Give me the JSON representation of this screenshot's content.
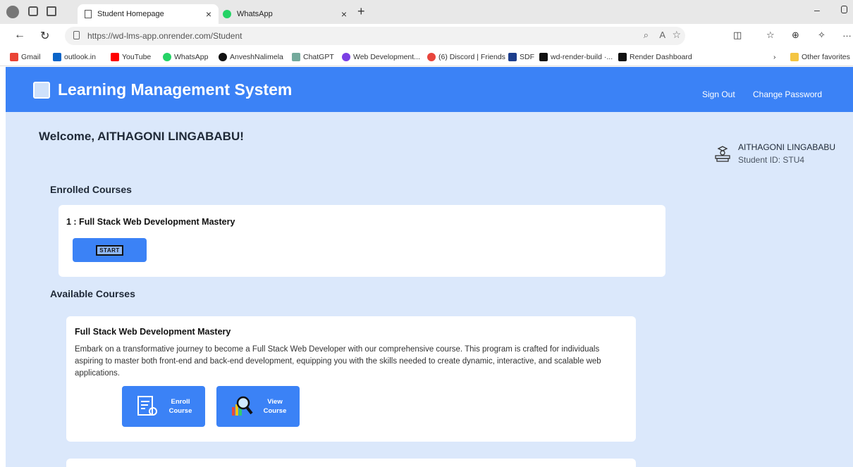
{
  "browser": {
    "tabs": [
      {
        "label": "Student Homepage",
        "active": true
      },
      {
        "label": "WhatsApp",
        "active": false
      }
    ],
    "url": "https://wd-lms-app.onrender.com/Student",
    "bookmarks": [
      "Gmail",
      "outlook.in",
      "YouTube",
      "WhatsApp",
      "AnveshNalimela",
      "ChatGPT",
      "Web Development...",
      "(6) Discord | Friends",
      "SDF",
      "wd-render-build ·...",
      "Render Dashboard"
    ],
    "other_favorites": "Other favorites"
  },
  "header": {
    "title": "Learning Management System",
    "sign_out": "Sign Out",
    "change_password": "Change Password"
  },
  "welcome": "Welcome, AITHAGONI LINGABABU!",
  "profile": {
    "name": "AITHAGONI LINGABABU",
    "student_id": "Student ID: STU4"
  },
  "enrolled": {
    "heading": "Enrolled Courses",
    "courses": [
      {
        "title": "1 : Full Stack Web Development Mastery",
        "start_label": "START"
      }
    ]
  },
  "available": {
    "heading": "Available Courses",
    "courses": [
      {
        "title": "Full Stack Web Development Mastery",
        "description_lines": [
          "Embark on a transformative journey to become a Full Stack Web Developer with our comprehensive course. This program is crafted for individuals",
          "aspiring to master both front-end and back-end development, equipping you with the skills needed to create dynamic, interactive, and scalable web",
          "applications."
        ],
        "enroll_label_1": "Enroll",
        "enroll_label_2": "Course",
        "view_label_1": "View",
        "view_label_2": "Course"
      }
    ]
  },
  "colors": {
    "accent": "#3b82f6",
    "page_bg": "#dbe8fb"
  }
}
